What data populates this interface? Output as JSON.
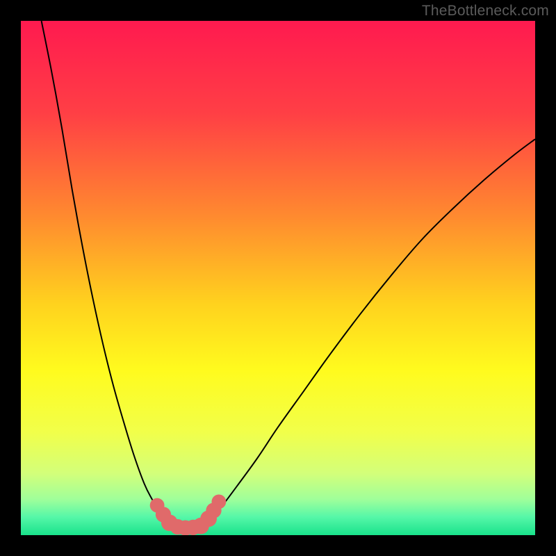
{
  "watermark": "TheBottleneck.com",
  "chart_data": {
    "type": "line",
    "title": "",
    "xlabel": "",
    "ylabel": "",
    "xlim": [
      0,
      100
    ],
    "ylim": [
      0,
      100
    ],
    "grid": false,
    "legend": false,
    "gradient_stops": [
      {
        "offset": 0.0,
        "color": "#ff1a4f"
      },
      {
        "offset": 0.18,
        "color": "#ff3f45"
      },
      {
        "offset": 0.38,
        "color": "#ff8a2f"
      },
      {
        "offset": 0.55,
        "color": "#ffd21e"
      },
      {
        "offset": 0.68,
        "color": "#fffb1e"
      },
      {
        "offset": 0.8,
        "color": "#f1ff4a"
      },
      {
        "offset": 0.88,
        "color": "#d3ff7a"
      },
      {
        "offset": 0.93,
        "color": "#a0ff9a"
      },
      {
        "offset": 0.965,
        "color": "#55f7a8"
      },
      {
        "offset": 1.0,
        "color": "#19e28b"
      }
    ],
    "series": [
      {
        "name": "left-branch",
        "x": [
          4,
          6,
          8,
          10,
          12,
          14,
          16,
          18,
          20,
          22,
          24,
          25.5,
          27,
          28,
          29,
          30
        ],
        "y": [
          100,
          90,
          79,
          67,
          56,
          46,
          37,
          29,
          22,
          15.5,
          10,
          7,
          4.5,
          3,
          2,
          1.5
        ]
      },
      {
        "name": "right-branch",
        "x": [
          35,
          37,
          39,
          42,
          46,
          50,
          55,
          60,
          66,
          72,
          78,
          84,
          90,
          96,
          100
        ],
        "y": [
          1.5,
          3,
          5.5,
          9.5,
          15,
          21,
          28,
          35,
          43,
          50.5,
          57.5,
          63.5,
          69,
          74,
          77
        ]
      },
      {
        "name": "valley-floor",
        "x": [
          30,
          31.5,
          33,
          34,
          35
        ],
        "y": [
          1.5,
          1.2,
          1.1,
          1.2,
          1.5
        ]
      }
    ],
    "markers": [
      {
        "x": 26.5,
        "y": 5.8,
        "r": 1.0
      },
      {
        "x": 27.7,
        "y": 4.0,
        "r": 1.1
      },
      {
        "x": 28.9,
        "y": 2.4,
        "r": 1.2
      },
      {
        "x": 30.5,
        "y": 1.6,
        "r": 1.1
      },
      {
        "x": 32.0,
        "y": 1.4,
        "r": 1.1
      },
      {
        "x": 33.5,
        "y": 1.5,
        "r": 1.1
      },
      {
        "x": 35.0,
        "y": 1.8,
        "r": 1.2
      },
      {
        "x": 36.5,
        "y": 3.2,
        "r": 1.2
      },
      {
        "x": 37.5,
        "y": 4.8,
        "r": 1.1
      },
      {
        "x": 38.5,
        "y": 6.5,
        "r": 1.0
      }
    ],
    "colors": {
      "curve": "#000000",
      "marker_fill": "#e06a6a",
      "marker_stroke": "#b34848"
    }
  }
}
